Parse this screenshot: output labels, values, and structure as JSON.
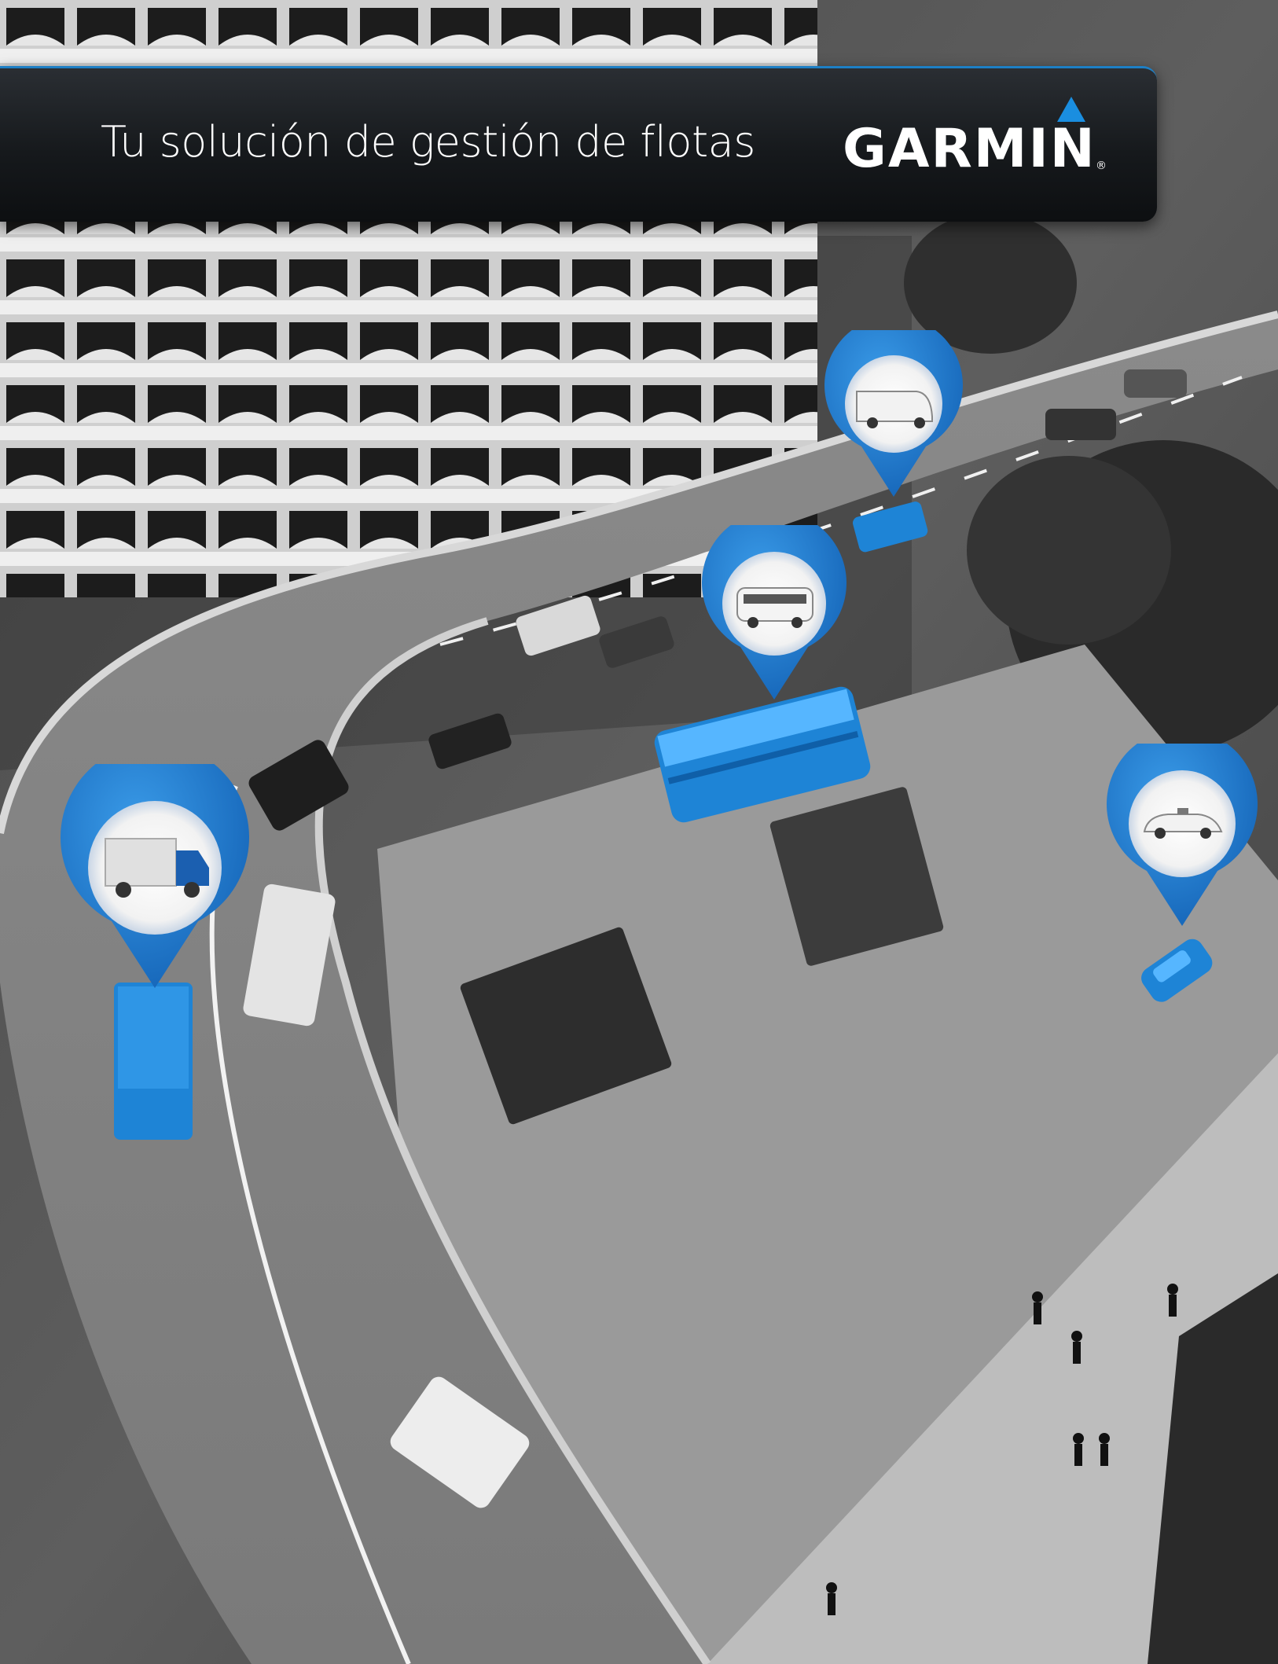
{
  "header": {
    "title": "Tu solución de gestión de flotas",
    "brand": "GARMIN",
    "registered_mark": "®"
  },
  "scene": {
    "style": "grayscale aerial city highway photo with vehicles highlighted in blue",
    "highlight_color": "#1e84d6",
    "accent_color": "#1a8ee0",
    "markers": [
      {
        "icon": "delivery-truck-icon"
      },
      {
        "icon": "double-decker-bus-icon"
      },
      {
        "icon": "van-icon"
      },
      {
        "icon": "taxi-car-icon"
      }
    ]
  }
}
